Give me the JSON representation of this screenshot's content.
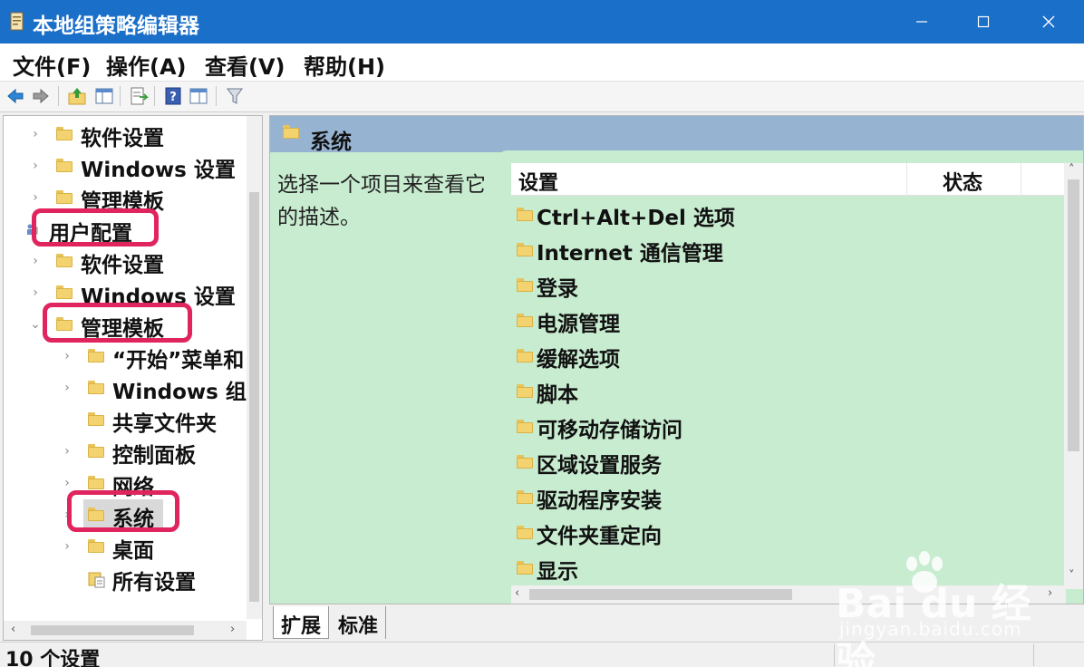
{
  "window": {
    "title": "本地组策略编辑器",
    "controls": {
      "minimize": "—",
      "maximize": "☐",
      "close": "✕"
    }
  },
  "menu": {
    "items": [
      "文件(F)",
      "操作(A)",
      "查看(V)",
      "帮助(H)"
    ]
  },
  "toolbar": {
    "icons": [
      "back-icon",
      "forward-icon",
      "up-folder-icon",
      "show-hide-tree-icon",
      "export-list-icon",
      "help-icon",
      "properties-icon",
      "filter-icon"
    ]
  },
  "tree": {
    "items": [
      {
        "label": "软件设置",
        "chevron": "›"
      },
      {
        "label": "Windows 设置",
        "chevron": "›"
      },
      {
        "label": "管理模板",
        "chevron": "›"
      },
      {
        "label": "用户配置",
        "chevron": ""
      },
      {
        "label": "软件设置",
        "chevron": "›"
      },
      {
        "label": "Windows 设置",
        "chevron": "›"
      },
      {
        "label": "管理模板",
        "chevron": "⌄"
      },
      {
        "label": "“开始”菜单和",
        "chevron": "›"
      },
      {
        "label": "Windows 组",
        "chevron": "›"
      },
      {
        "label": "共享文件夹",
        "chevron": ""
      },
      {
        "label": "控制面板",
        "chevron": "›"
      },
      {
        "label": "网络",
        "chevron": "›"
      },
      {
        "label": "系统",
        "chevron": "›"
      },
      {
        "label": "桌面",
        "chevron": "›"
      },
      {
        "label": "所有设置",
        "chevron": ""
      }
    ],
    "scroll": {
      "left": "‹",
      "right": "›"
    }
  },
  "right_pane": {
    "header_title": "系统",
    "description": "选择一个项目来查看它的描述。",
    "columns": {
      "setting": "设置",
      "status": "状态"
    },
    "rows": [
      "Ctrl+Alt+Del 选项",
      "Internet 通信管理",
      "登录",
      "电源管理",
      "缓解选项",
      "脚本",
      "可移动存储访问",
      "区域设置服务",
      "驱动程序安装",
      "文件夹重定向",
      "显示"
    ],
    "scroll": {
      "up": "˄",
      "down": "˅",
      "left": "‹",
      "right": "›"
    }
  },
  "bottom_tabs": {
    "extended": "扩展",
    "standard": "标准"
  },
  "status_bar": {
    "text": "10 个设置"
  },
  "watermark": {
    "logo": "Bai du 经验",
    "url": "jingyan.baidu.com"
  }
}
